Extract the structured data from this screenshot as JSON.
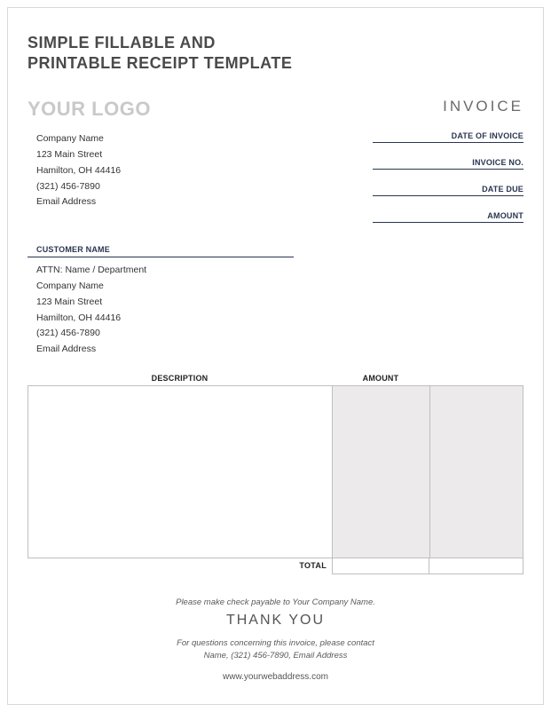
{
  "title_line1": "SIMPLE FILLABLE AND",
  "title_line2": "PRINTABLE RECEIPT TEMPLATE",
  "logo_text": "YOUR LOGO",
  "invoice_label": "INVOICE",
  "company": {
    "name": "Company Name",
    "street": "123 Main Street",
    "city": "Hamilton, OH  44416",
    "phone": "(321) 456-7890",
    "email": "Email Address"
  },
  "meta": {
    "date_of_invoice": "DATE OF INVOICE",
    "invoice_no": "INVOICE NO.",
    "date_due": "DATE DUE",
    "amount": "AMOUNT"
  },
  "customer_header": "CUSTOMER NAME",
  "customer": {
    "attn": "ATTN: Name / Department",
    "name": "Company Name",
    "street": "123 Main Street",
    "city": "Hamilton, OH  44416",
    "phone": "(321) 456-7890",
    "email": "Email Address"
  },
  "table": {
    "description_header": "DESCRIPTION",
    "amount_header": "AMOUNT",
    "total_label": "TOTAL"
  },
  "footer": {
    "payable": "Please make check payable to Your Company Name.",
    "thankyou": "THANK YOU",
    "contact_line1": "For questions concerning this invoice, please contact",
    "contact_line2": "Name, (321) 456-7890, Email Address",
    "url": "www.yourwebaddress.com"
  }
}
